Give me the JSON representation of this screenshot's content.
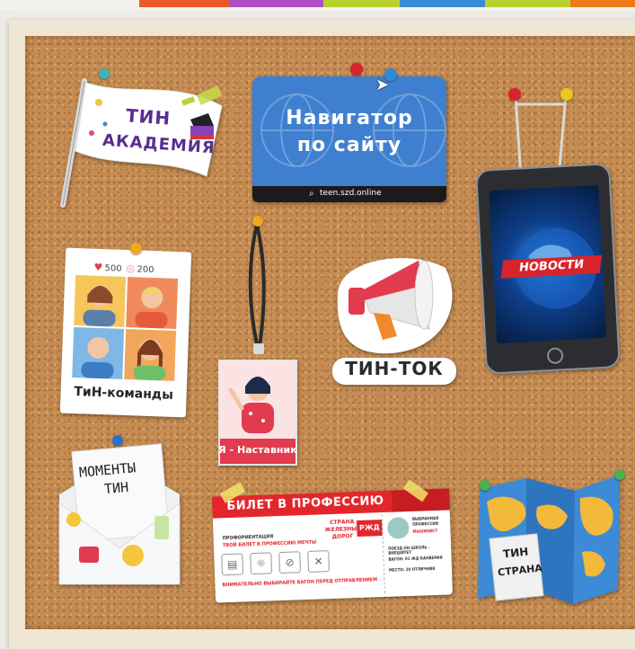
{
  "colors": {
    "cork": "#c48b52",
    "frame": "#efe6d4",
    "navigator_blue": "#3f7fcf",
    "news_red": "#d8232a",
    "ticket_red": "#e3262c",
    "accent_purple": "#8a3dbe"
  },
  "top_stripes": [
    "#e85a2a",
    "#b04fc5",
    "#b9d12f",
    "#3a8bd6",
    "#f07a1a"
  ],
  "board": {
    "academy": {
      "line1": "ТИН",
      "line2": "АКАДЕМИЯ"
    },
    "navigator": {
      "line1": "Навигатор",
      "line2": "по сайту",
      "url": "teen.szd.online"
    },
    "news": {
      "label": "НОВОСТИ"
    },
    "teams": {
      "likes": "500",
      "followers": "200",
      "label": "ТиН-команды"
    },
    "mentor": {
      "label": "Я - Наставник"
    },
    "tin_tok": {
      "label": "ТИН-ТОК"
    },
    "moments": {
      "line1": "МОМЕНТЫ",
      "line2": "ТИН"
    },
    "ticket": {
      "header": "БИЛЕТ В ПРОФЕССИЮ",
      "brand_line1": "СТРАНА",
      "brand_line2": "ЖЕЛЕЗНЫХ",
      "brand_line3": "ДОРОГ",
      "logo": "РЖД",
      "left_title1": "ПРОФОРИЕНТАЦИЯ",
      "left_title2": "ТВОЙ БИЛЕТ В ПРОФЕССИЮ МЕЧТЫ",
      "bottom_note": "ВНИМАТЕЛЬНО ВЫБИРАЙТЕ ВАГОН ПЕРЕД ОТПРАВЛЕНИЕМ",
      "right_head1": "ВЫБРАННАЯ",
      "right_head2": "ПРОФЕССИЯ",
      "right_head3": "МАШИНИСТ",
      "row1": "ПОЕЗД ОН ШКОЛЬ - ВНЕШИТЕТ",
      "row2": "ВАГОН: 01 ЖД КАНВЕРИЯ",
      "row3": "МЕСТО: 20 ОТЛИЧНИК"
    },
    "country": {
      "line1": "ТИН",
      "line2": "СТРАНА"
    }
  }
}
